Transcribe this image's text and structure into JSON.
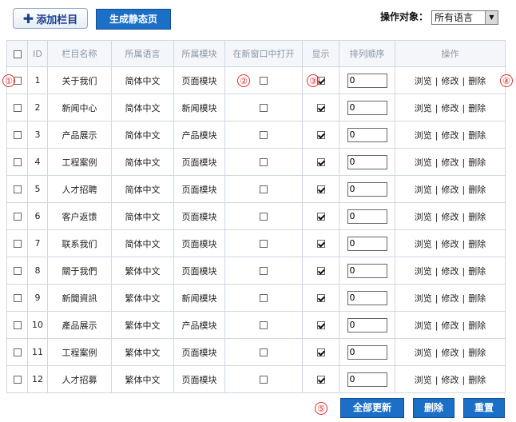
{
  "toolbar": {
    "add_label": "添加栏目",
    "generate_label": "生成静态页",
    "target_label": "操作对象：",
    "target_value": "所有语言"
  },
  "table": {
    "headers": [
      "ID",
      "栏目名称",
      "所属语言",
      "所属模块",
      "在新窗口中打开",
      "显示",
      "排列顺序",
      "操作"
    ],
    "ops": {
      "browse": "浏览",
      "edit": "修改",
      "delete": "删除",
      "sep": "|"
    },
    "rows": [
      {
        "id": "1",
        "name": "关于我们",
        "lang": "简体中文",
        "module": "页面模块",
        "new_window": false,
        "show": true,
        "order": "0"
      },
      {
        "id": "2",
        "name": "新闻中心",
        "lang": "简体中文",
        "module": "新闻模块",
        "new_window": false,
        "show": true,
        "order": "0"
      },
      {
        "id": "3",
        "name": "产品展示",
        "lang": "简体中文",
        "module": "产品模块",
        "new_window": false,
        "show": true,
        "order": "0"
      },
      {
        "id": "4",
        "name": "工程案例",
        "lang": "简体中文",
        "module": "页面模块",
        "new_window": false,
        "show": true,
        "order": "0"
      },
      {
        "id": "5",
        "name": "人才招聘",
        "lang": "简体中文",
        "module": "页面模块",
        "new_window": false,
        "show": true,
        "order": "0"
      },
      {
        "id": "6",
        "name": "客户返馈",
        "lang": "简体中文",
        "module": "页面模块",
        "new_window": false,
        "show": true,
        "order": "0"
      },
      {
        "id": "7",
        "name": "联系我们",
        "lang": "简体中文",
        "module": "页面模块",
        "new_window": false,
        "show": true,
        "order": "0"
      },
      {
        "id": "8",
        "name": "關于我們",
        "lang": "繁体中文",
        "module": "页面模块",
        "new_window": false,
        "show": true,
        "order": "0"
      },
      {
        "id": "9",
        "name": "新聞資訊",
        "lang": "繁体中文",
        "module": "新闻模块",
        "new_window": false,
        "show": true,
        "order": "0"
      },
      {
        "id": "10",
        "name": "產品展示",
        "lang": "繁体中文",
        "module": "产品模块",
        "new_window": false,
        "show": true,
        "order": "0"
      },
      {
        "id": "11",
        "name": "工程案例",
        "lang": "繁体中文",
        "module": "页面模块",
        "new_window": false,
        "show": true,
        "order": "0"
      },
      {
        "id": "12",
        "name": "人才招募",
        "lang": "繁体中文",
        "module": "页面模块",
        "new_window": false,
        "show": true,
        "order": "0"
      }
    ]
  },
  "footer": {
    "update_all_label": "全部更新",
    "delete_label": "删除",
    "reset_label": "重置"
  },
  "annotations": [
    "①",
    "②",
    "③",
    "④",
    "⑤"
  ],
  "colors": {
    "button_blue": "#1b6fc7",
    "annotation_red": "#e03030",
    "border": "#cfd7e3"
  }
}
